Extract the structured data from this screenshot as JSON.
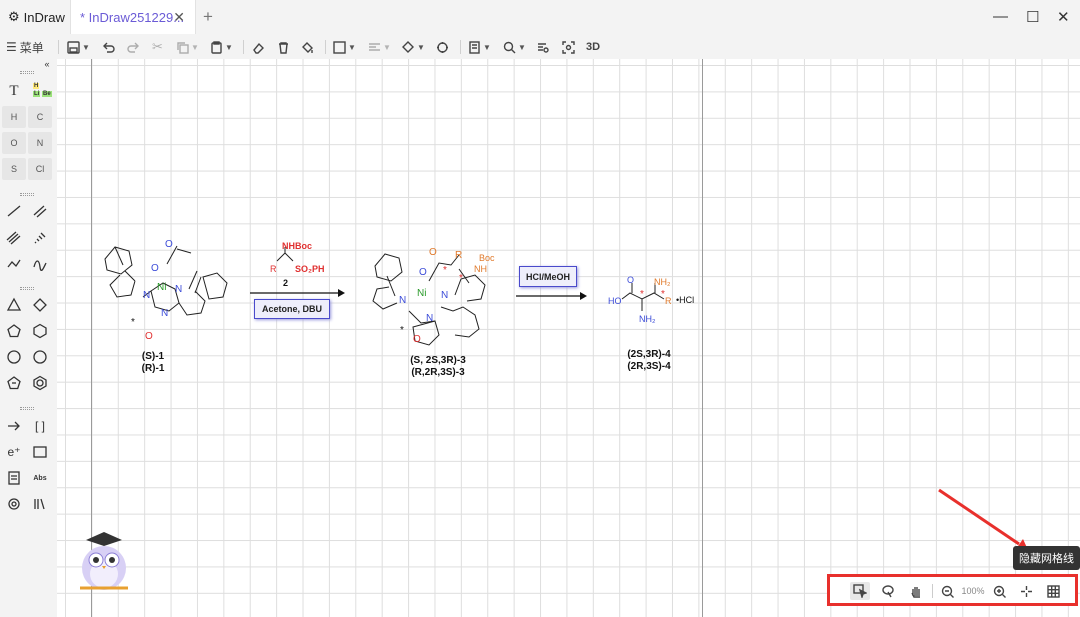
{
  "app": {
    "home_tab": "InDraw",
    "doc_tab": "* InDraw251229...",
    "new_tab": "+"
  },
  "window": {
    "minimize": "—",
    "maximize": "☐",
    "close": "✕"
  },
  "toolbar": {
    "menu_label": "菜单",
    "label_3d": "3D"
  },
  "sidebar": {
    "text_tool": "T",
    "periodic": [
      "H",
      "Li",
      "Be"
    ],
    "atoms": [
      "H",
      "C",
      "O",
      "N",
      "S",
      "Cl"
    ],
    "charge_label": "e⁺",
    "abbrev_label": "Abs",
    "bracket_label": "[ ]"
  },
  "scheme": {
    "reagent_r": "R",
    "reagent_nhboc": "NHBoc",
    "reagent_so2ph": "SO₂PH",
    "reagent_number": "2",
    "condition_1": "Acetone, DBU",
    "condition_2": "HCl/MeOH",
    "compound1_labels": [
      "(S)-1",
      "(R)-1"
    ],
    "compound3_labels": [
      "(S, 2S,3R)-3",
      "(R,2R,3S)-3"
    ],
    "compound4_labels": [
      "(2S,3R)-4",
      "(2R,3S)-4"
    ],
    "atom_ni": "Ni",
    "atom_n": "N",
    "atom_o": "O",
    "atom_boc": "Boc",
    "atom_nh": "NH",
    "atom_nh2": "NH₂",
    "atom_ho": "HO",
    "hcl": "•HCl",
    "star": "*"
  },
  "bottombar": {
    "zoom": "100%"
  },
  "tooltip": {
    "text": "隐藏网格线"
  },
  "colors": {
    "accent": "#6b5bd6",
    "annotation": "#e8302c",
    "blue_atom": "#3b4bd8",
    "orange": "#e0792a",
    "red_atom": "#e03030",
    "green_ni": "#2a9a2a"
  }
}
